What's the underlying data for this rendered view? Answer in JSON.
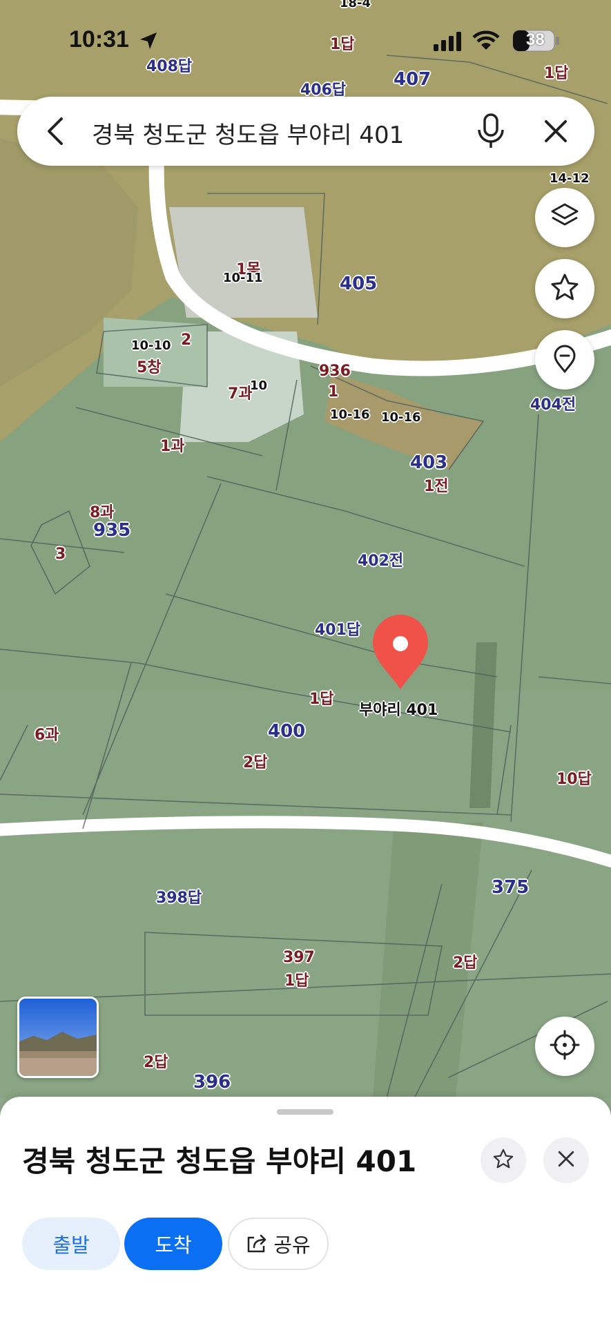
{
  "status": {
    "time": "10:31",
    "battery": "38"
  },
  "search": {
    "query": "경북 청도군 청도읍 부야리 401"
  },
  "map": {
    "marker_label": "부야리 401",
    "parcels": [
      {
        "id": "p1",
        "text": "18-4"
      },
      {
        "id": "p2",
        "text": "1답"
      },
      {
        "id": "p3",
        "text": "408답"
      },
      {
        "id": "p4",
        "text": "406답"
      },
      {
        "id": "p5",
        "text": "407"
      },
      {
        "id": "p6",
        "text": "1답"
      },
      {
        "id": "p7",
        "text": "14-12"
      },
      {
        "id": "p8",
        "text": "1목"
      },
      {
        "id": "p9",
        "text": "10-11"
      },
      {
        "id": "p10",
        "text": "405"
      },
      {
        "id": "p11",
        "text": "10-10"
      },
      {
        "id": "p12",
        "text": "2"
      },
      {
        "id": "p13",
        "text": "5창"
      },
      {
        "id": "p14",
        "text": "936"
      },
      {
        "id": "p15",
        "text": "7과"
      },
      {
        "id": "p16",
        "text": "10"
      },
      {
        "id": "p17",
        "text": "1"
      },
      {
        "id": "p18",
        "text": "10-16"
      },
      {
        "id": "p19",
        "text": "10-16"
      },
      {
        "id": "p20",
        "text": "404전"
      },
      {
        "id": "p21",
        "text": "1과"
      },
      {
        "id": "p22",
        "text": "403"
      },
      {
        "id": "p23",
        "text": "1전"
      },
      {
        "id": "p24",
        "text": "8과"
      },
      {
        "id": "p25",
        "text": "935"
      },
      {
        "id": "p26",
        "text": "3"
      },
      {
        "id": "p27",
        "text": "402전"
      },
      {
        "id": "p28",
        "text": "401답"
      },
      {
        "id": "p29",
        "text": "1답"
      },
      {
        "id": "p30",
        "text": "6과"
      },
      {
        "id": "p31",
        "text": "400"
      },
      {
        "id": "p32",
        "text": "2답"
      },
      {
        "id": "p33",
        "text": "10답"
      },
      {
        "id": "p34",
        "text": "398답"
      },
      {
        "id": "p35",
        "text": "375"
      },
      {
        "id": "p36",
        "text": "397"
      },
      {
        "id": "p37",
        "text": "1답"
      },
      {
        "id": "p38",
        "text": "2답"
      },
      {
        "id": "p39",
        "text": "2답"
      },
      {
        "id": "p40",
        "text": "396"
      }
    ]
  },
  "sheet": {
    "title": "경북 청도군 청도읍 부야리 401",
    "start_label": "출발",
    "arrive_label": "도착",
    "share_label": "공유"
  },
  "colors": {
    "accent": "#0a6ff2",
    "marker": "#f0524a"
  },
  "icons": [
    "back-icon",
    "mic-icon",
    "close-icon",
    "layers-icon",
    "star-icon",
    "pin-icon",
    "locate-icon",
    "share-icon",
    "location-arrow-icon",
    "signal-icon",
    "wifi-icon",
    "battery-icon"
  ]
}
